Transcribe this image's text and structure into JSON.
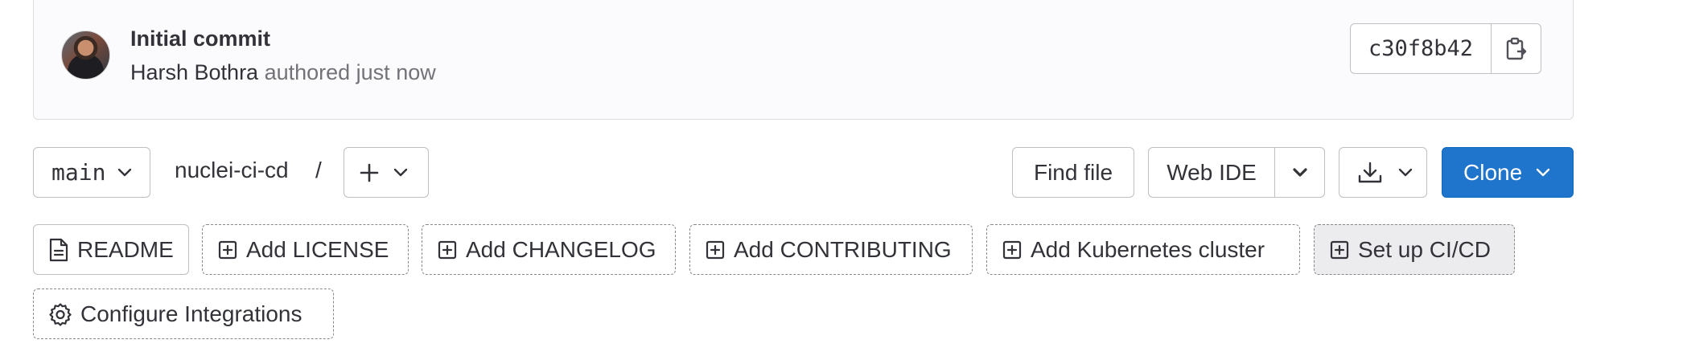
{
  "commit": {
    "title": "Initial commit",
    "author": "Harsh Bothra",
    "meta": " authored just now",
    "sha": "c30f8b42"
  },
  "toolbar": {
    "branch": "main",
    "path": "nuclei-ci-cd",
    "separator": "/",
    "find_file": "Find file",
    "web_ide": "Web IDE",
    "clone": "Clone"
  },
  "suggestions": {
    "readme": "README",
    "license": "Add LICENSE",
    "changelog": "Add CHANGELOG",
    "contributing": "Add CONTRIBUTING",
    "kubernetes": "Add Kubernetes cluster",
    "cicd": "Set up CI/CD",
    "integrations": "Configure Integrations"
  },
  "colors": {
    "accent": "#1f75cb",
    "text": "#333238",
    "muted": "#737278"
  }
}
